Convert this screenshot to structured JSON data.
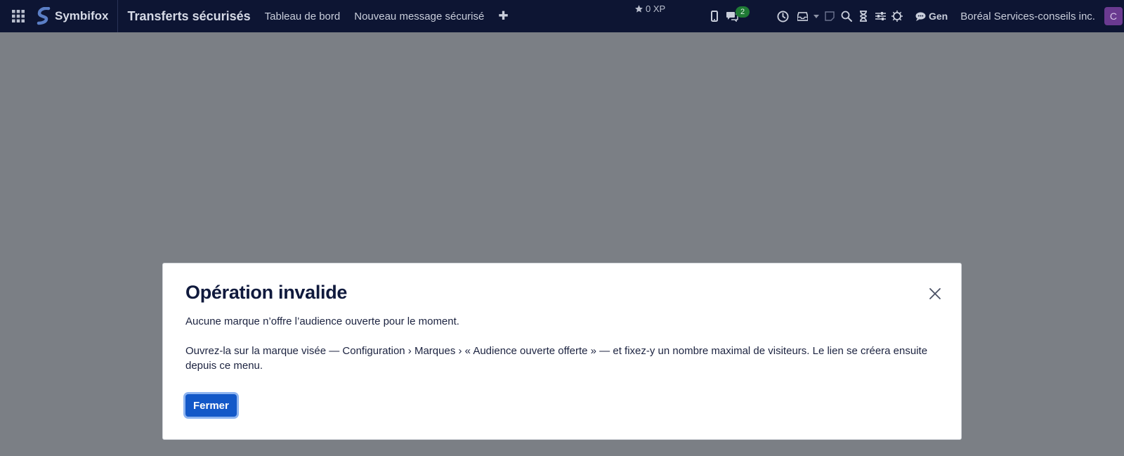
{
  "topbar": {
    "brand_name": "Symbifox",
    "app_title": "Transferts sécurisés",
    "nav": [
      {
        "label": "Tableau de bord"
      },
      {
        "label": "Nouveau message sécurisé"
      }
    ],
    "add_label": "✚",
    "xp_label": "0 XP",
    "chat_badge": "2",
    "gen_label": "Gen",
    "company": "Boréal Services-conseils inc.",
    "avatar_initial": "C"
  },
  "dialog": {
    "title": "Opération invalide",
    "line1": "Aucune marque n’offre l’audience ouverte pour le moment.",
    "line2": "Ouvrez-la sur la marque visée — Configuration › Marques › « Audience ouverte offerte » — et fixez-y un nombre maximal de visiteurs. Le lien se créera ensuite depuis ce menu.",
    "close_button": "Fermer"
  },
  "colors": {
    "topbar_bg": "#0d1533",
    "backdrop": "#7b7f85",
    "primary_button": "#1358c8",
    "avatar_bg": "#6a3a90",
    "badge_bg": "#1f7a35"
  }
}
